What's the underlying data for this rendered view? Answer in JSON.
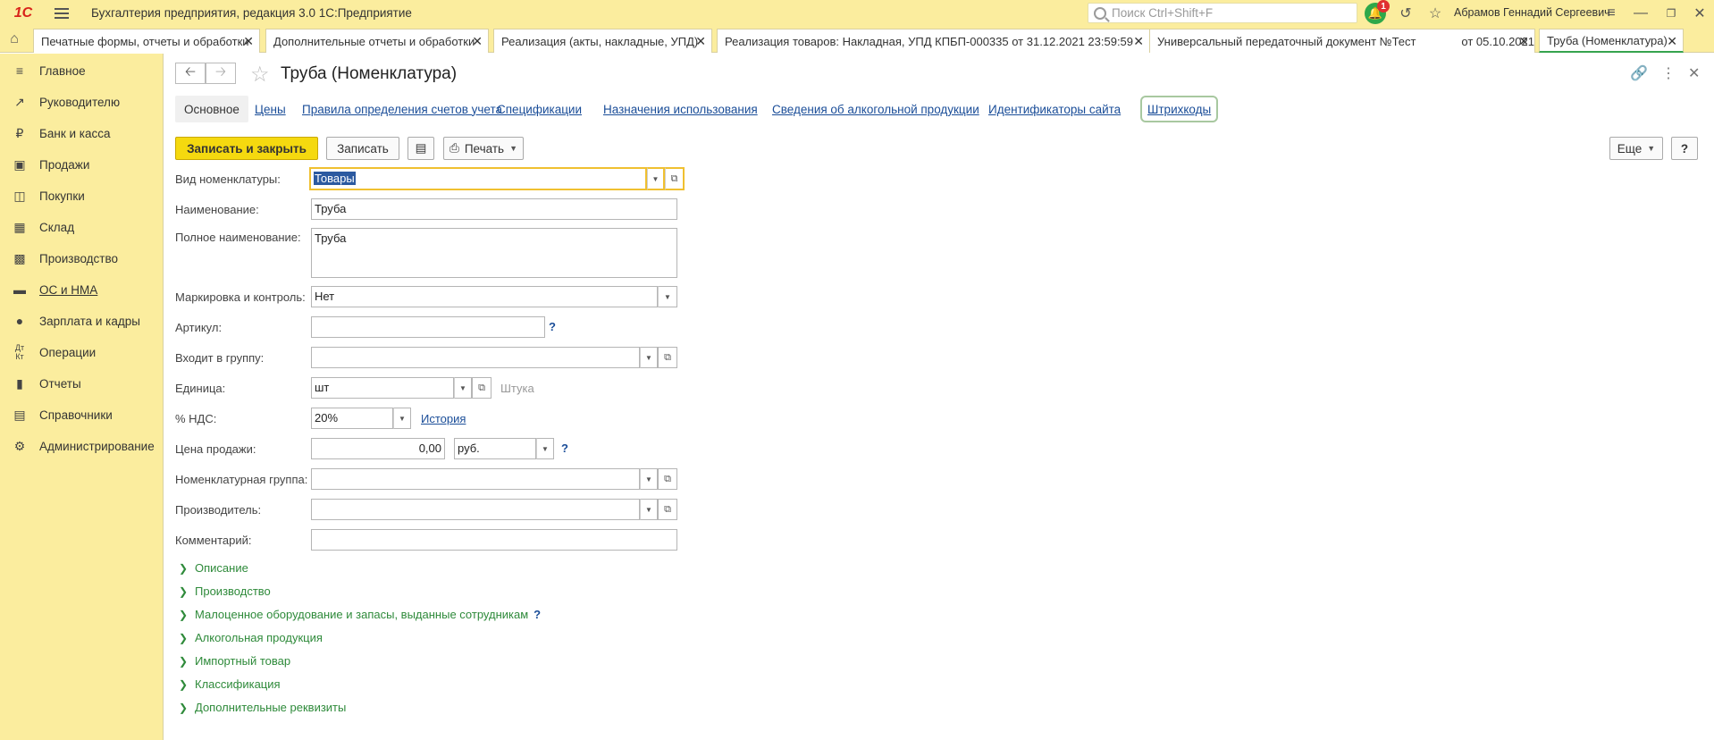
{
  "app": {
    "logo": "1С",
    "title": "Бухгалтерия предприятия, редакция 3.0 1С:Предприятие",
    "search_placeholder": "Поиск Ctrl+Shift+F",
    "notifications_count": "1",
    "user": "Абрамов Геннадий Сергеевич"
  },
  "tabs": [
    {
      "label": "Печатные формы, отчеты и обработки"
    },
    {
      "label": "Дополнительные отчеты и обработки"
    },
    {
      "label": "Реализация (акты, накладные, УПД)"
    },
    {
      "label": "Реализация товаров: Накладная, УПД КПБП-000335 от 31.12.2021 23:59:59"
    },
    {
      "label": "Универсальный передаточный документ №Тест"
    },
    {
      "label": "от 05.10.2021"
    },
    {
      "label": "Труба (Номенклатура)"
    }
  ],
  "sidebar": {
    "items": [
      {
        "label": "Главное",
        "icon": "menu-icon"
      },
      {
        "label": "Руководителю",
        "icon": "trend-icon"
      },
      {
        "label": "Банк и касса",
        "icon": "ruble-icon"
      },
      {
        "label": "Продажи",
        "icon": "bag-icon"
      },
      {
        "label": "Покупки",
        "icon": "cart-icon"
      },
      {
        "label": "Склад",
        "icon": "grid-icon"
      },
      {
        "label": "Производство",
        "icon": "factory-icon"
      },
      {
        "label": "ОС и НМА",
        "icon": "truck-icon"
      },
      {
        "label": "Зарплата и кадры",
        "icon": "person-icon"
      },
      {
        "label": "Операции",
        "icon": "dt-kt-icon"
      },
      {
        "label": "Отчеты",
        "icon": "bar-chart-icon"
      },
      {
        "label": "Справочники",
        "icon": "book-icon"
      },
      {
        "label": "Администрирование",
        "icon": "gear-icon"
      }
    ]
  },
  "form": {
    "title": "Труба (Номенклатура)",
    "sections": [
      "Основное",
      "Цены",
      "Правила определения счетов учета",
      "Спецификации",
      "Назначения использования",
      "Сведения об алкогольной продукции",
      "Идентификаторы сайта",
      "Штрихкоды"
    ],
    "buttons": {
      "save_close": "Записать и закрыть",
      "save": "Записать",
      "print": "Печать",
      "more": "Еще",
      "help": "?"
    },
    "labels": {
      "kind": "Вид номенклатуры:",
      "name": "Наименование:",
      "full_name": "Полное наименование:",
      "marking": "Маркировка и контроль:",
      "article": "Артикул:",
      "group": "Входит в группу:",
      "unit": "Единица:",
      "vat": "% НДС:",
      "price": "Цена продажи:",
      "nom_group": "Номенклатурная группа:",
      "manufacturer": "Производитель:",
      "comment": "Комментарий:"
    },
    "values": {
      "kind": "Товары",
      "name": "Труба",
      "full_name": "Труба",
      "marking": "Нет",
      "article": "",
      "group": "",
      "unit": "шт",
      "unit_full": "Штука",
      "vat": "20%",
      "vat_history": "История",
      "price": "0,00",
      "currency": "руб.",
      "nom_group": "",
      "manufacturer": "",
      "comment": ""
    },
    "hint": "?",
    "groups": [
      "Описание",
      "Производство",
      "Малоценное оборудование и запасы, выданные сотрудникам",
      "Алкогольная продукция",
      "Импортный товар",
      "Классификация",
      "Дополнительные реквизиты"
    ]
  }
}
